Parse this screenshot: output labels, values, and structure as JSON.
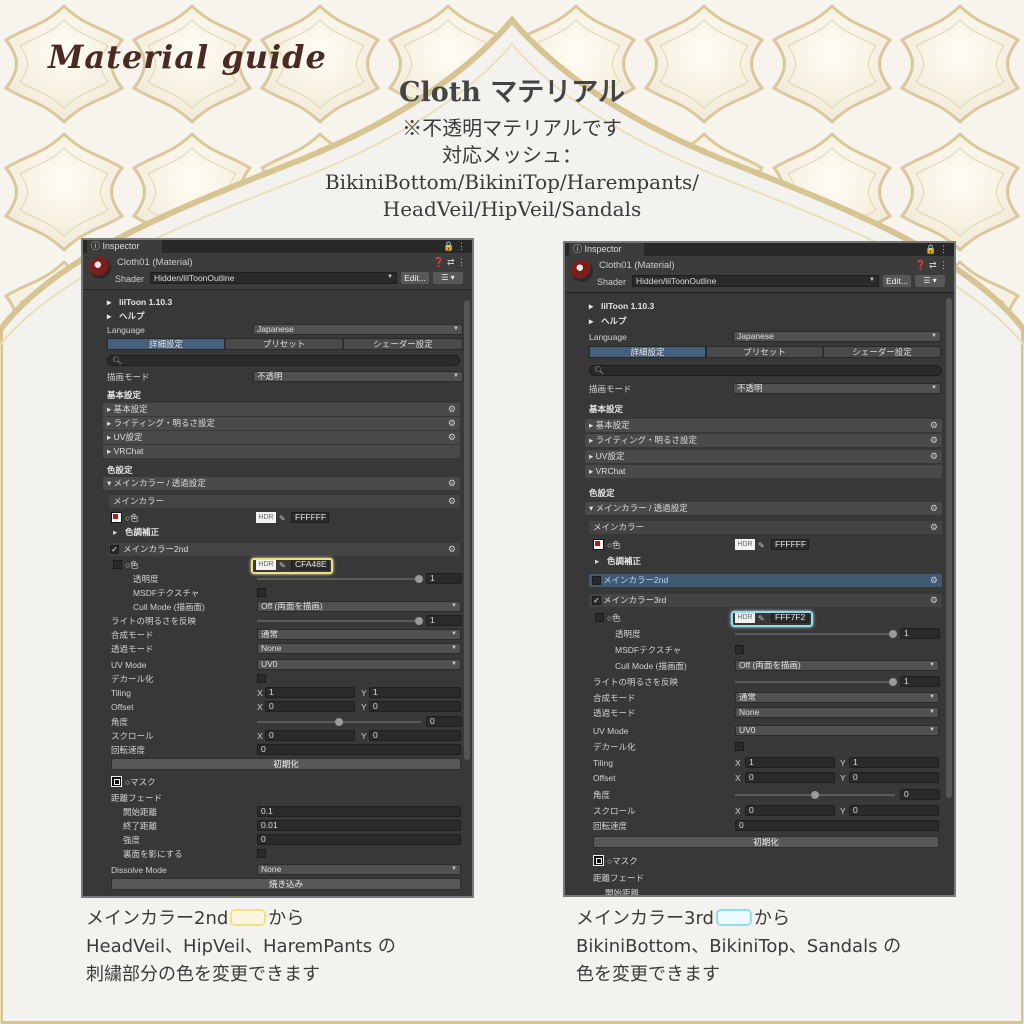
{
  "header": {
    "guide_title": "Material guide",
    "main_title": "Cloth マテリアル",
    "note": "※不透明マテリアルです",
    "mesh_label": "対応メッシュ：",
    "mesh_list_1": "BikiniBottom/BikiniTop/Harempants/",
    "mesh_list_2": "HeadVeil/HipVeil/Sandals"
  },
  "inspector": {
    "tab": "Inspector",
    "material_name": "Cloth01 (Material)",
    "shader_label": "Shader",
    "shader_value": "Hidden/lilToonOutline",
    "edit_label": "Edit...",
    "menu_icon": "list-icon",
    "liltoon_version": "lilToon 1.10.3",
    "help": "ヘルプ",
    "language_label": "Language",
    "language_value": "Japanese",
    "tabs": [
      "詳細設定",
      "プリセット",
      "シェーダー設定"
    ],
    "render_mode_label": "描画モード",
    "render_mode_value": "不透明",
    "basic_settings": "基本設定",
    "sections": [
      "基本設定",
      "ライティング・明るさ設定",
      "UV設定",
      "VRChat"
    ],
    "color_settings": "色設定",
    "main_color_section": "メインカラー / 透過設定",
    "main_color": "メインカラー",
    "color_label": "○色",
    "hdr": "HDR",
    "main_hex": "FFFFFF",
    "color_correction": "色調補正",
    "main_color_2nd": "メインカラー2nd",
    "main_color_3rd": "メインカラー3rd",
    "hex_2nd": "CFA48E",
    "hex_3rd": "FFF7F2",
    "opacity_label": "透明度",
    "opacity_value": "1",
    "msdf_label": "MSDFテクスチャ",
    "cull_label": "Cull Mode (描画面)",
    "cull_value": "Off (両面を描画)",
    "invert_light_label": "ライトの明るさを反映",
    "invert_light_value": "1",
    "blend_label": "合成モード",
    "blend_value": "通常",
    "alpha_mode_label": "透過モード",
    "alpha_mode_value": "None",
    "uv_mode_label": "UV Mode",
    "uv_mode_value": "UV0",
    "decal_label": "デカール化",
    "tiling_label": "Tiling",
    "offset_label": "Offset",
    "x": "X",
    "y": "Y",
    "tiling_x": "1",
    "tiling_y": "1",
    "offset_x": "0",
    "offset_y": "0",
    "angle_label": "角度",
    "angle_value": "0",
    "scroll_label": "スクロール",
    "scroll_x": "0",
    "scroll_y": "0",
    "rotation_speed_label": "回転速度",
    "rotation_speed_value": "0",
    "init_button": "初期化",
    "mask_label": "○マスク",
    "distance_fade_label": "距離フェード",
    "fade_start_label": "開始距離",
    "fade_start_value": "0.1",
    "fade_end_label": "終了距離",
    "fade_end_value": "0.01",
    "fade_strength_label": "強度",
    "fade_strength_value": "0",
    "backface_label": "裏面を影にする",
    "dissolve_label": "Dissolve Mode",
    "dissolve_value": "None",
    "bake_button": "焼き込み",
    "right_fade_start_partial": "開始距離"
  },
  "captions": {
    "left_1a": "メインカラー2nd",
    "left_1b": "から",
    "left_2": "HeadVeil、HipVeil、HaremPants の",
    "left_3": "刺繍部分の色を変更できます",
    "right_1a": "メインカラー3rd",
    "right_1b": "から",
    "right_2": "BikiniBottom、BikiniTop、Sandals の",
    "right_3": "色を変更できます"
  },
  "colors": {
    "highlight_2nd": "#efe27f",
    "highlight_3rd": "#8fdfee",
    "active_tab": "#46607c"
  }
}
